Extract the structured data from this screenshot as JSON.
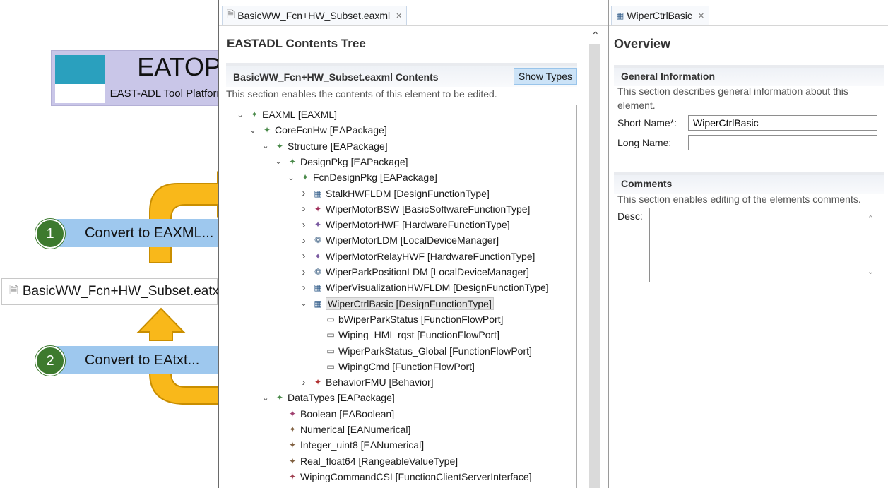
{
  "logo": {
    "title": "EATOP",
    "subtitle": "EAST-ADL Tool Platform"
  },
  "left": {
    "eatxt_file": "BasicWW_Fcn+HW_Subset.eatxt",
    "convert1": {
      "num": "1",
      "label": "Convert to EAXML..."
    },
    "convert2": {
      "num": "2",
      "label": "Convert to EAtxt..."
    }
  },
  "middle": {
    "tab_label": "BasicWW_Fcn+HW_Subset.eaxml",
    "tab_close": "✕",
    "title": "EASTADL Contents Tree",
    "section_title": "BasicWW_Fcn+HW_Subset.eaxml Contents",
    "show_types": "Show Types",
    "section_desc": "This section enables the contents of this element to be edited.",
    "tree": [
      {
        "label": "EAXML [EAXML]",
        "twisty": "expanded",
        "icon": "package-icon"
      },
      {
        "label": "CoreFcnHw [EAPackage]",
        "twisty": "expanded",
        "icon": "package-icon"
      },
      {
        "label": "Structure [EAPackage]",
        "twisty": "expanded",
        "icon": "package-icon"
      },
      {
        "label": "DesignPkg [EAPackage]",
        "twisty": "expanded",
        "icon": "package-icon"
      },
      {
        "label": "FcnDesignPkg [EAPackage]",
        "twisty": "expanded",
        "icon": "package-icon"
      },
      {
        "label": "StalkHWFLDM [DesignFunctionType]",
        "twisty": "collapsed",
        "icon": "design-function-icon"
      },
      {
        "label": "WiperMotorBSW [BasicSoftwareFunctionType]",
        "twisty": "collapsed",
        "icon": "basic-software-icon"
      },
      {
        "label": "WiperMotorHWF [HardwareFunctionType]",
        "twisty": "collapsed",
        "icon": "hardware-function-icon"
      },
      {
        "label": "WiperMotorLDM [LocalDeviceManager]",
        "twisty": "collapsed",
        "icon": "local-device-icon"
      },
      {
        "label": "WiperMotorRelayHWF [HardwareFunctionType]",
        "twisty": "collapsed",
        "icon": "hardware-function-icon"
      },
      {
        "label": "WiperParkPositionLDM [LocalDeviceManager]",
        "twisty": "collapsed",
        "icon": "local-device-icon"
      },
      {
        "label": "WiperVisualizationHWFLDM [DesignFunctionType]",
        "twisty": "collapsed",
        "icon": "design-function-icon"
      },
      {
        "label": "WiperCtrlBasic [DesignFunctionType]",
        "twisty": "expanded",
        "icon": "design-function-icon"
      },
      {
        "label": "bWiperParkStatus [FunctionFlowPort]",
        "twisty": "none",
        "icon": "flow-port-icon"
      },
      {
        "label": "Wiping_HMI_rqst [FunctionFlowPort]",
        "twisty": "none",
        "icon": "flow-port-icon"
      },
      {
        "label": "WiperParkStatus_Global [FunctionFlowPort]",
        "twisty": "none",
        "icon": "flow-port-icon"
      },
      {
        "label": "WipingCmd [FunctionFlowPort]",
        "twisty": "none",
        "icon": "flow-port-icon"
      },
      {
        "label": "BehaviorFMU [Behavior]",
        "twisty": "collapsed",
        "icon": "behavior-icon"
      },
      {
        "label": "DataTypes [EAPackage]",
        "twisty": "expanded",
        "icon": "package-icon"
      },
      {
        "label": "Boolean [EABoolean]",
        "twisty": "none",
        "icon": "datatype-boolean-icon"
      },
      {
        "label": "Numerical [EANumerical]",
        "twisty": "none",
        "icon": "datatype-icon"
      },
      {
        "label": "Integer_uint8 [EANumerical]",
        "twisty": "none",
        "icon": "datatype-icon"
      },
      {
        "label": "Real_float64 [RangeableValueType]",
        "twisty": "none",
        "icon": "datatype-icon"
      },
      {
        "label": "WipingCommandCSI [FunctionClientServerInterface]",
        "twisty": "none",
        "icon": "interface-icon"
      }
    ],
    "selected_index": 12
  },
  "right": {
    "tab_label": "WiperCtrlBasic",
    "tab_close": "✕",
    "title": "Overview",
    "general": {
      "title": "General Information",
      "desc": "This section describes general information about this element.",
      "short_name_label": "Short Name*:",
      "short_name_value": "WiperCtrlBasic",
      "long_name_label": "Long Name:",
      "long_name_value": ""
    },
    "comments": {
      "title": "Comments",
      "desc": "This section enables editing of the elements comments.",
      "desc_label": "Desc:",
      "desc_value": ""
    }
  },
  "colors": {
    "arrow_fill": "#f9b81a",
    "arrow_stroke": "#c98e00",
    "convert_bg": "#9ec8ee",
    "step_circle": "#3d7a2e",
    "logo_bg": "#c9c6e8",
    "logo_teal": "#2aa0be"
  }
}
